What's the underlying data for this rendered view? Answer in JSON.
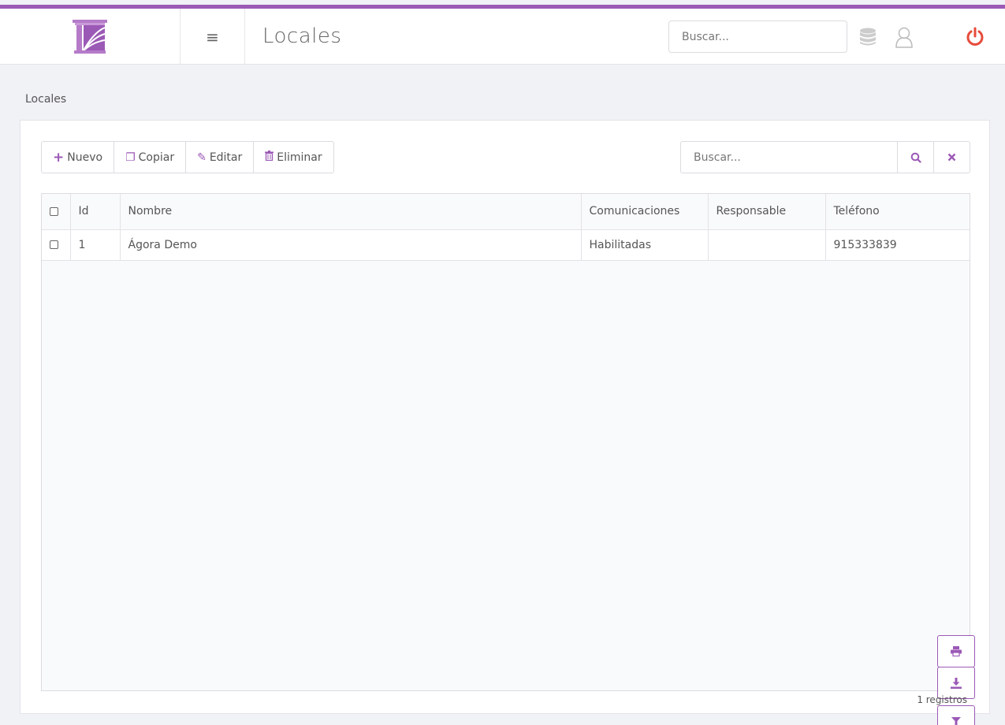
{
  "header": {
    "title": "Locales",
    "search_placeholder": "Buscar...",
    "logo_icon": "building-logo-icon",
    "menu_icon": "menu-icon",
    "database_icon": "database-icon",
    "user_icon": "user-icon",
    "power_icon": "power-icon",
    "accent_color": "#9b59b6",
    "power_color": "#e74c3c"
  },
  "breadcrumb": "Locales",
  "toolbar": {
    "new_label": "Nuevo",
    "copy_label": "Copiar",
    "edit_label": "Editar",
    "delete_label": "Eliminar",
    "search_placeholder": "Buscar...",
    "search_icon": "search-icon",
    "clear_icon": "clear-icon"
  },
  "table": {
    "columns": [
      "Id",
      "Nombre",
      "Comunicaciones",
      "Responsable",
      "Teléfono"
    ],
    "rows": [
      {
        "id": "1",
        "nombre": "Ágora Demo",
        "comunicaciones": "Habilitadas",
        "responsable": "",
        "telefono": "915333839"
      }
    ]
  },
  "footer": {
    "count_label": "1 registros",
    "print_icon": "print-icon",
    "download_icon": "download-icon",
    "filter_icon": "filter-icon"
  }
}
